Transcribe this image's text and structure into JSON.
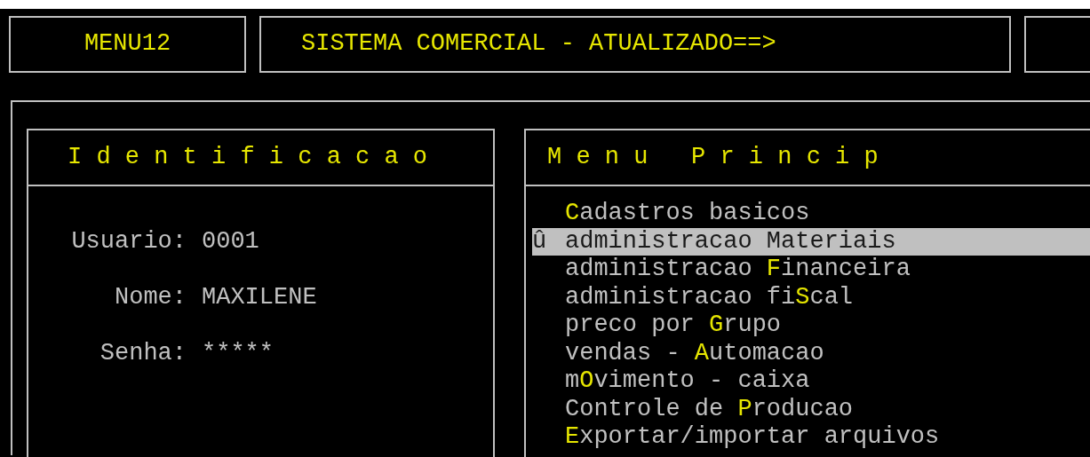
{
  "header": {
    "program": "MENU12",
    "title": "SISTEMA COMERCIAL - ATUALIZADO==>"
  },
  "identification": {
    "title": "I d e n t i f i c a c a o",
    "fields": [
      {
        "label": "Usuario:",
        "value": "0001"
      },
      {
        "label": "Nome:",
        "value": "MAXILENE"
      },
      {
        "label": "Senha:",
        "value": "*****"
      }
    ]
  },
  "menu": {
    "title": "M e n u   P r i n c i p",
    "cursor": "û",
    "items": [
      {
        "hotkey": "C",
        "after": "adastros basicos",
        "selected": false
      },
      {
        "before": "administracao ",
        "hotkey": "M",
        "after": "ateriais",
        "selected": true
      },
      {
        "before": "administracao ",
        "hotkey": "F",
        "after": "inanceira",
        "selected": false
      },
      {
        "before": "administracao fi",
        "hotkey": "S",
        "after": "cal",
        "selected": false
      },
      {
        "before": "preco por ",
        "hotkey": "G",
        "after": "rupo",
        "selected": false
      },
      {
        "before": "vendas - ",
        "hotkey": "A",
        "after": "utomacao",
        "selected": false
      },
      {
        "before": "m",
        "hotkey": "O",
        "after": "vimento - caixa",
        "selected": false
      },
      {
        "before": "Controle de ",
        "hotkey": "P",
        "after": "roducao",
        "selected": false
      },
      {
        "hotkey": "E",
        "after": "xportar/importar arquivos",
        "selected": false
      }
    ]
  }
}
